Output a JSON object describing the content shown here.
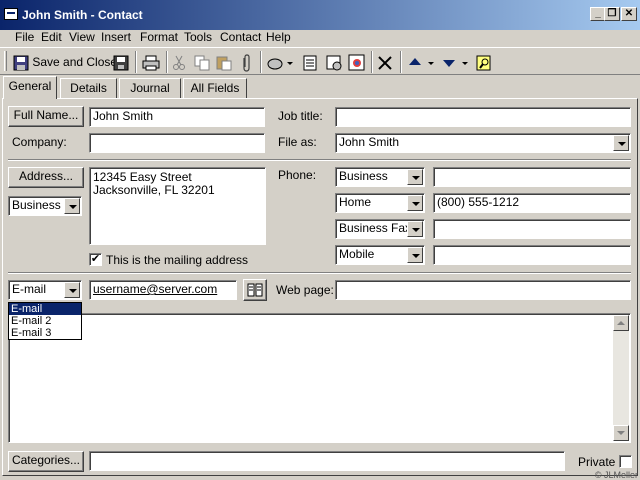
{
  "window": {
    "title": "John Smith - Contact",
    "controls": [
      "_",
      "❐",
      "✕"
    ]
  },
  "menu": [
    "File",
    "Edit",
    "View",
    "Insert",
    "Format",
    "Tools",
    "Contact",
    "Help"
  ],
  "toolbar": {
    "save_close_label": "Save and Close",
    "icons": [
      "save-icon",
      "print-icon",
      "cut-icon",
      "copy-icon",
      "paste-icon",
      "attach-icon",
      "followup-icon",
      "new-meeting-icon",
      "task-icon",
      "call-icon",
      "delete-icon",
      "previous-item-icon",
      "next-item-icon",
      "address-book-icon"
    ]
  },
  "tabs": [
    "General",
    "Details",
    "Journal",
    "All Fields"
  ],
  "general": {
    "full_name_button": "Full Name...",
    "full_name_value": "John Smith",
    "job_title_label": "Job title:",
    "job_title_value": "",
    "company_label": "Company:",
    "company_value": "",
    "file_as_label": "File as:",
    "file_as_value": "John Smith",
    "address_button": "Address...",
    "address_line1": "12345 Easy Street",
    "address_line2": "Jacksonville, FL  32201",
    "address_type": "Business",
    "mailing_checkbox_label": "This is the mailing address",
    "mailing_checked": "✔",
    "phone_label": "Phone:",
    "phones": [
      {
        "type": "Business",
        "value": ""
      },
      {
        "type": "Home",
        "value": "(800) 555-1212"
      },
      {
        "type": "Business Fax",
        "value": ""
      },
      {
        "type": "Mobile",
        "value": ""
      }
    ],
    "email_type": "E-mail",
    "email_value": "username@server.com",
    "email_options": [
      "E-mail",
      "E-mail 2",
      "E-mail 3"
    ],
    "web_page_label": "Web page:",
    "web_page_value": "",
    "notes_value": "",
    "categories_button": "Categories...",
    "categories_value": "",
    "private_label": "Private",
    "credit": "© JLMeller"
  }
}
